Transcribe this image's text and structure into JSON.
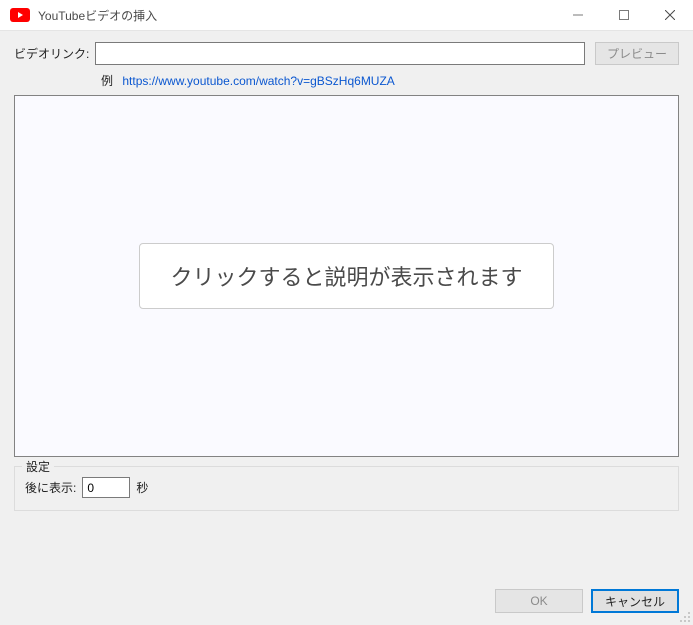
{
  "titlebar": {
    "title": "YouTubeビデオの挿入"
  },
  "link": {
    "label": "ビデオリンク:",
    "value": "",
    "placeholder": ""
  },
  "preview_button": "プレビュー",
  "example": {
    "label": "例",
    "url": "https://www.youtube.com/watch?v=gBSzHq6MUZA"
  },
  "preview_placeholder": "クリックすると説明が表示されます",
  "settings": {
    "legend": "設定",
    "show_after_label": "後に表示:",
    "show_after_value": "0",
    "seconds_suffix": "秒"
  },
  "buttons": {
    "ok": "OK",
    "cancel": "キャンセル"
  }
}
